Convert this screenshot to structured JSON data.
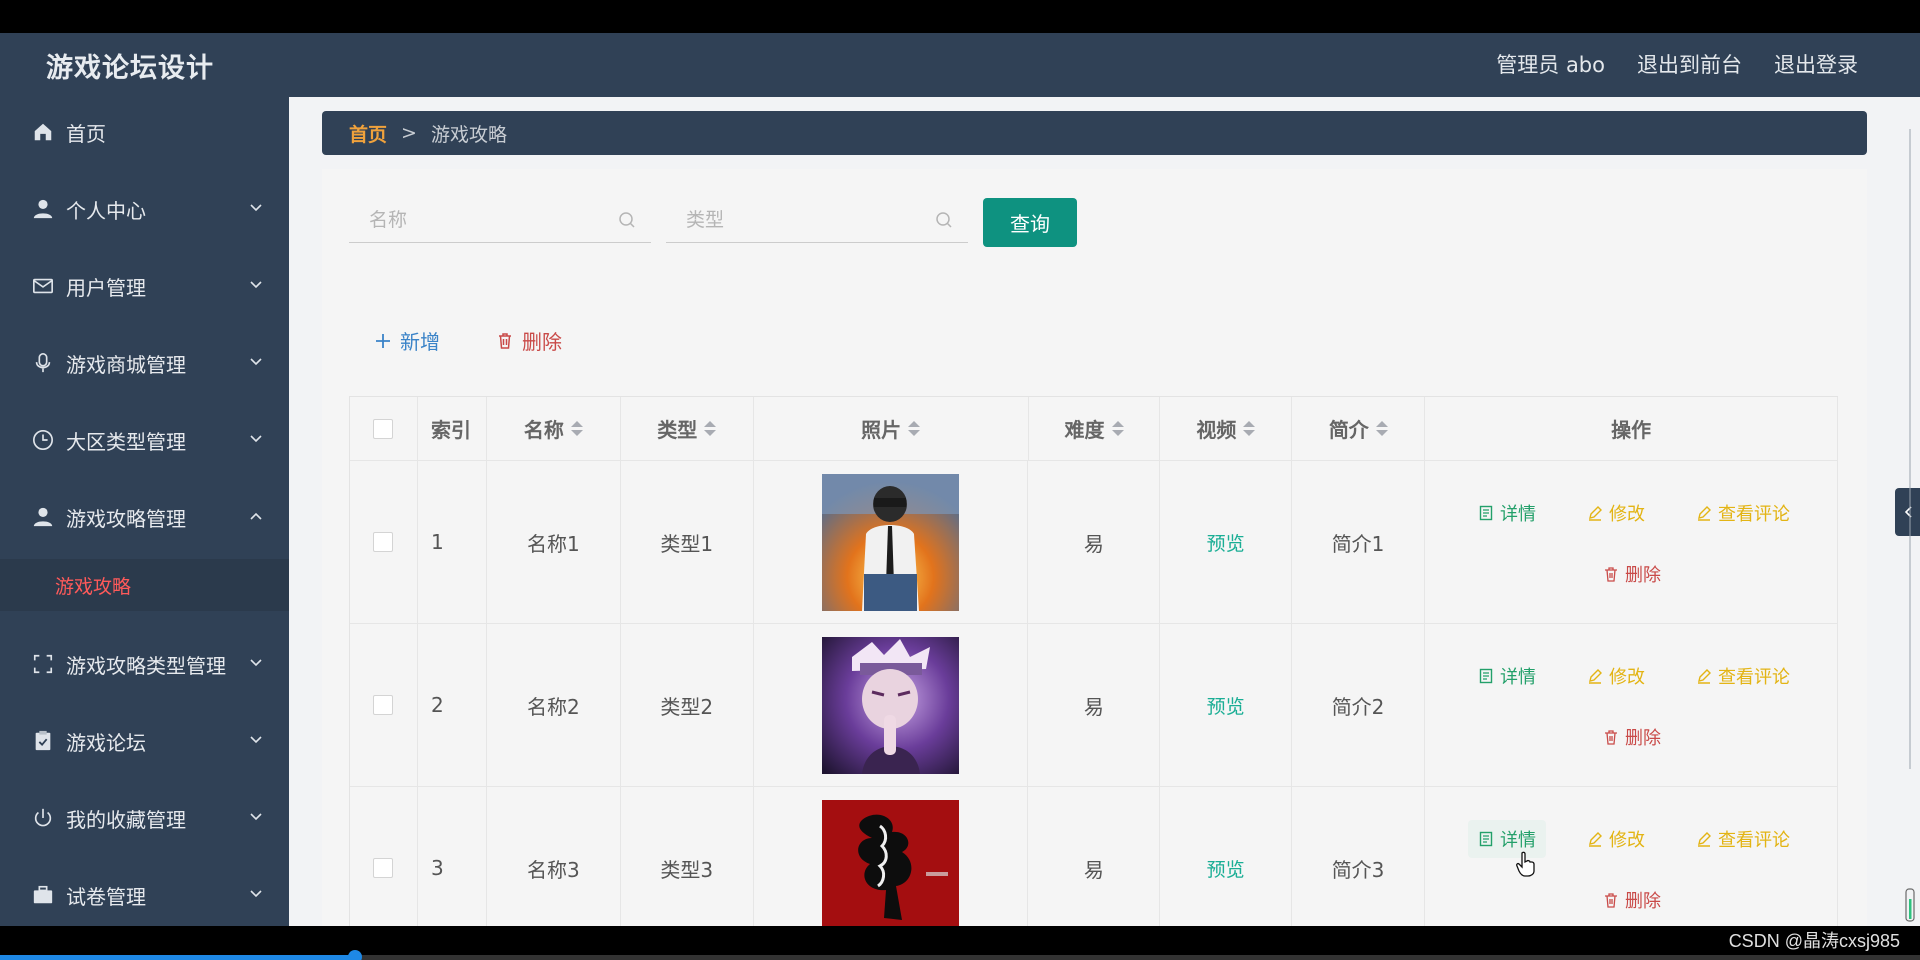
{
  "header": {
    "app_title": "游戏论坛设计",
    "admin_label": "管理员 abo",
    "exit_front_label": "退出到前台",
    "logout_label": "退出登录"
  },
  "sidebar": {
    "items": [
      {
        "label": "首页",
        "icon": "home-icon"
      },
      {
        "label": "个人中心",
        "icon": "user-icon"
      },
      {
        "label": "用户管理",
        "icon": "mail-icon"
      },
      {
        "label": "游戏商城管理",
        "icon": "microphone-icon"
      },
      {
        "label": "大区类型管理",
        "icon": "clock-icon"
      },
      {
        "label": "游戏攻略管理",
        "icon": "user-icon"
      },
      {
        "label": "游戏攻略类型管理",
        "icon": "fullscreen-icon"
      },
      {
        "label": "游戏论坛",
        "icon": "clipboard-check-icon"
      },
      {
        "label": "我的收藏管理",
        "icon": "power-icon"
      },
      {
        "label": "试卷管理",
        "icon": "briefcase-icon"
      }
    ],
    "active_sub_item": "游戏攻略"
  },
  "breadcrumb": {
    "home": "首页",
    "separator": ">",
    "current": "游戏攻略"
  },
  "search": {
    "name_placeholder": "名称",
    "type_placeholder": "类型",
    "query_label": "查询"
  },
  "actions": {
    "add_label": "新增",
    "delete_label": "删除"
  },
  "table": {
    "columns": [
      "索引",
      "名称",
      "类型",
      "照片",
      "难度",
      "视频",
      "简介",
      "操作"
    ],
    "rows": [
      {
        "index": "1",
        "name": "名称1",
        "type": "类型1",
        "photo": "soldier-photo",
        "difficulty": "易",
        "video": "预览",
        "intro": "简介1"
      },
      {
        "index": "2",
        "name": "名称2",
        "type": "类型2",
        "photo": "anime-character-photo",
        "difficulty": "易",
        "video": "预览",
        "intro": "简介2"
      },
      {
        "index": "3",
        "name": "名称3",
        "type": "类型3",
        "photo": "red-silhouette-photo",
        "difficulty": "易",
        "video": "预览",
        "intro": "简介3"
      }
    ],
    "op_labels": {
      "detail": "详情",
      "edit": "修改",
      "comments": "查看评论",
      "delete": "删除"
    }
  },
  "colors": {
    "sidebar_bg": "#304156",
    "query_button": "#0e9280",
    "breadcrumb_home": "#f0a23c",
    "active_sub_item": "#ff5a5a",
    "detail": "#23a06a",
    "edit": "#e3b414",
    "delete": "#c94a48",
    "preview": "#1aae95"
  },
  "video_progress": 0.185,
  "watermark": "CSDN @晶涛cxsj985"
}
